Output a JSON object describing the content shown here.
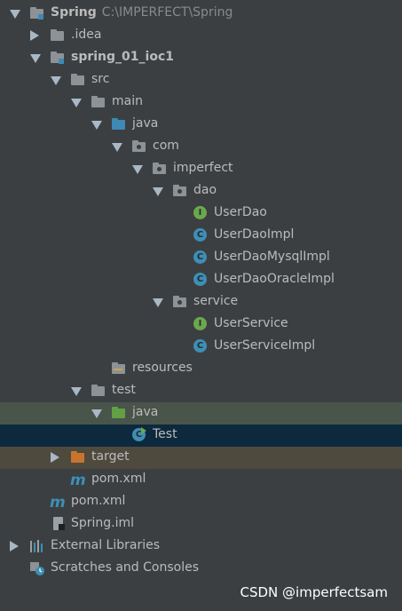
{
  "tree": [
    {
      "id": "spring",
      "label": "Spring",
      "path": "C:\\IMPERFECT\\Spring",
      "bold": true
    },
    {
      "id": "idea",
      "label": ".idea"
    },
    {
      "id": "spring-01-ioc1",
      "label": "spring_01_ioc1",
      "bold": true
    },
    {
      "id": "src",
      "label": "src"
    },
    {
      "id": "main",
      "label": "main"
    },
    {
      "id": "java-main",
      "label": "java"
    },
    {
      "id": "com",
      "label": "com"
    },
    {
      "id": "imperfect",
      "label": "imperfect"
    },
    {
      "id": "dao",
      "label": "dao"
    },
    {
      "id": "userdao",
      "label": "UserDao"
    },
    {
      "id": "userdaoimpl",
      "label": "UserDaoImpl"
    },
    {
      "id": "userdaomysqlimpl",
      "label": "UserDaoMysqlImpl"
    },
    {
      "id": "userdaooracleimpl",
      "label": "UserDaoOracleImpl"
    },
    {
      "id": "service",
      "label": "service"
    },
    {
      "id": "userservice",
      "label": "UserService"
    },
    {
      "id": "userserviceimpl",
      "label": "UserServiceImpl"
    },
    {
      "id": "resources",
      "label": "resources"
    },
    {
      "id": "test-folder",
      "label": "test"
    },
    {
      "id": "java-test",
      "label": "java"
    },
    {
      "id": "test-class",
      "label": "Test"
    },
    {
      "id": "target",
      "label": "target"
    },
    {
      "id": "pom-module",
      "label": "pom.xml"
    },
    {
      "id": "pom-root",
      "label": "pom.xml"
    },
    {
      "id": "spring-iml",
      "label": "Spring.iml"
    },
    {
      "id": "external-libraries",
      "label": "External Libraries"
    },
    {
      "id": "scratches",
      "label": "Scratches and Consoles"
    }
  ],
  "icon_letters": {
    "interface": "I",
    "class": "C"
  },
  "watermark": "CSDN @imperfectsam",
  "colors": {
    "background": "#3c3f41",
    "text": "#bbbbbb",
    "path_text": "#8a8a8a",
    "folder_gray": "#8c9296",
    "folder_blue": "#3d8ab5",
    "folder_green": "#62a046",
    "folder_orange": "#c9742d",
    "interface_icon": "#6aa84f",
    "class_icon": "#3d8fb6",
    "test_row": "#49544a",
    "selected_row": "#0d293e",
    "excluded_row": "#4f4a3e"
  }
}
